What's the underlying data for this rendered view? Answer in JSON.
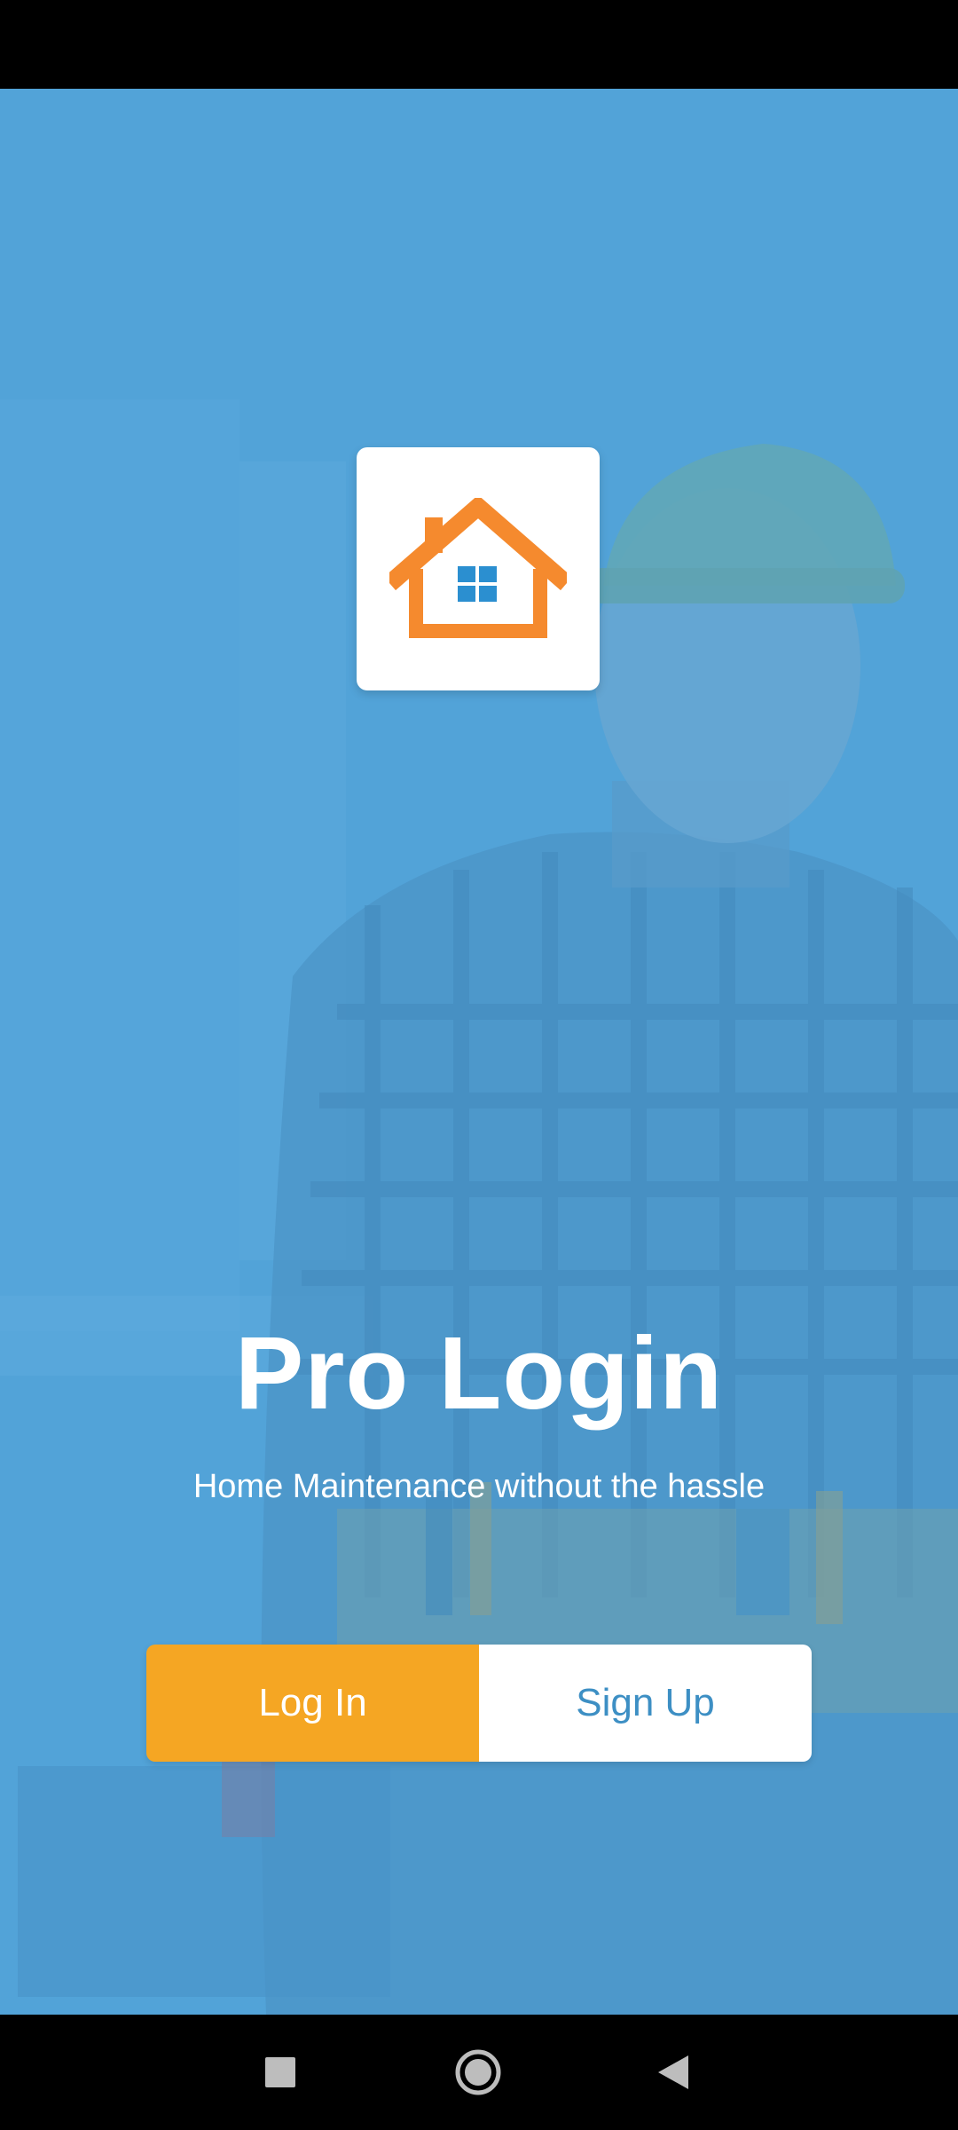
{
  "app": {
    "title": "Pro Login",
    "subtitle": "Home Maintenance without the hassle",
    "login_label": "Log In",
    "signup_label": "Sign Up"
  },
  "icons": {
    "logo": "house-icon",
    "nav_recents": "square-icon",
    "nav_home": "circle-icon",
    "nav_back": "triangle-back-icon"
  },
  "colors": {
    "background_tint": "#5aa6d8",
    "primary_button": "#f5a623",
    "secondary_button_text": "#3d8fc4",
    "logo_house": "#f58a2e",
    "logo_window": "#2b8fd0"
  }
}
